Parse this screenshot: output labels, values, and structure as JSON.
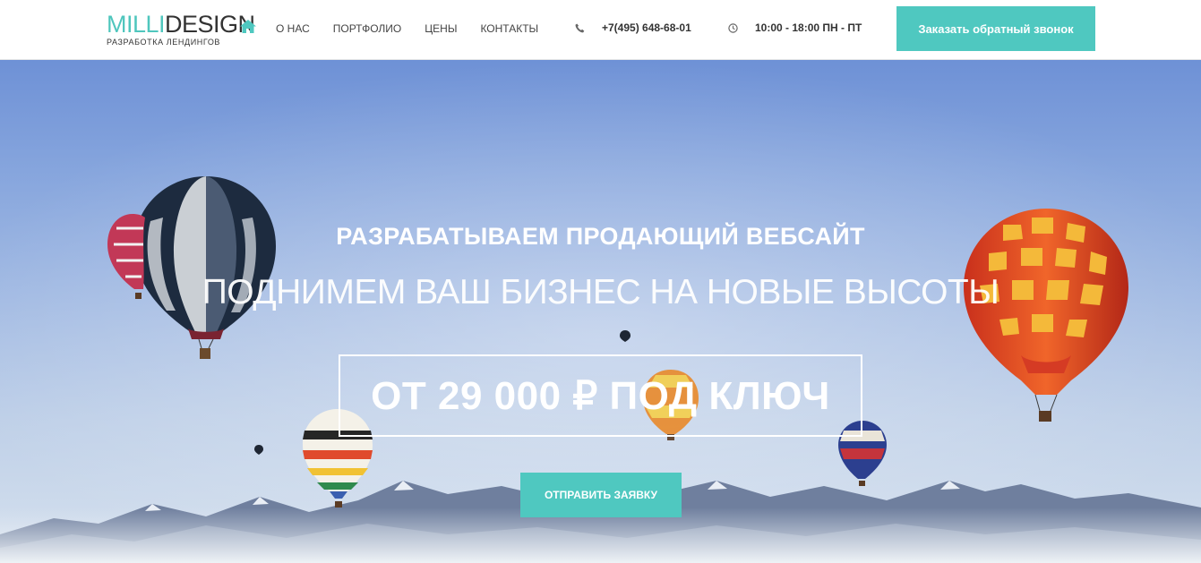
{
  "logo": {
    "name_accent": "MILLI",
    "name_main": "DESIGN",
    "tagline": "РАЗРАБОТКА ЛЕНДИНГОВ"
  },
  "nav": {
    "home_icon": "home-icon",
    "items": [
      {
        "label": "О НАС"
      },
      {
        "label": "ПОРТФОЛИО"
      },
      {
        "label": "ЦЕНЫ"
      },
      {
        "label": "КОНТАКТЫ"
      }
    ]
  },
  "contact": {
    "phone_icon": "phone-icon",
    "phone": "+7(495) 648-68-01",
    "clock_icon": "clock-icon",
    "hours": "10:00 - 18:00 ПН - ПТ"
  },
  "header": {
    "callback_label": "Заказать обратный звонок"
  },
  "hero": {
    "title": "РАЗРАБАТЫВАЕМ ПРОДАЮЩИЙ ВЕБСАЙТ",
    "subtitle": "ПОДНИМЕМ ВАШ БИЗНЕС НА НОВЫЕ ВЫСОТЫ",
    "price": "ОТ 29 000 ₽ ПОД КЛЮЧ",
    "submit_label": "ОТПРАВИТЬ ЗАЯВКУ"
  },
  "colors": {
    "accent": "#4fc8c0",
    "text_dark": "#333333",
    "header_bg": "#ffffff"
  }
}
